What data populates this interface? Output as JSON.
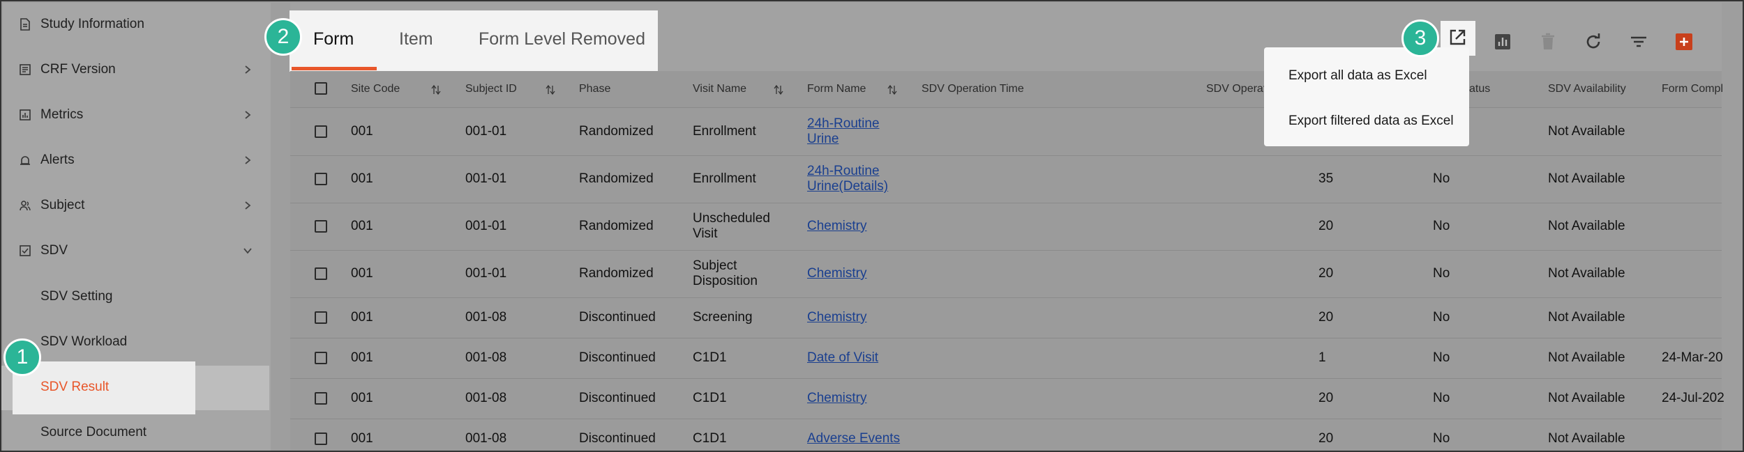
{
  "sidebar": {
    "items": [
      {
        "label": "Study Information",
        "icon": "document-icon",
        "expand": ""
      },
      {
        "label": "CRF Version",
        "icon": "form-icon",
        "expand": "chevron-right"
      },
      {
        "label": "Metrics",
        "icon": "chart-icon",
        "expand": "chevron-right"
      },
      {
        "label": "Alerts",
        "icon": "alarm-icon",
        "expand": "chevron-right"
      },
      {
        "label": "Subject",
        "icon": "people-icon",
        "expand": "chevron-right"
      },
      {
        "label": "SDV",
        "icon": "checklist-icon",
        "expand": "chevron-down"
      }
    ],
    "sub_items": [
      {
        "label": "SDV Setting"
      },
      {
        "label": "SDV Workload"
      },
      {
        "label": "SDV Result",
        "active": true
      },
      {
        "label": "Source Document"
      }
    ]
  },
  "tabs": [
    {
      "label": "Form",
      "active": true
    },
    {
      "label": "Item"
    },
    {
      "label": "Form Level Removed"
    }
  ],
  "toolbar": {
    "icons": [
      "export-icon",
      "bar-chart-icon",
      "delete-icon",
      "refresh-icon",
      "filter-icon",
      "add-icon"
    ]
  },
  "export_menu": {
    "items": [
      "Export all data as Excel",
      "Export filtered data as Excel"
    ]
  },
  "table": {
    "columns": [
      "Site Code",
      "Subject ID",
      "Phase",
      "Visit Name",
      "Form Name",
      "SDV Operation Time",
      "SDV Operator",
      "atus",
      "SDV Availability",
      "Form Compl"
    ],
    "rows": [
      {
        "site": "001",
        "subject": "001-01",
        "phase": "Randomized",
        "visit": [
          "Enrollment"
        ],
        "form": [
          "24h-Routine",
          "Urine"
        ],
        "count": "",
        "status": "",
        "avail": "Not Available",
        "completed": ""
      },
      {
        "site": "001",
        "subject": "001-01",
        "phase": "Randomized",
        "visit": [
          "Enrollment"
        ],
        "form": [
          "24h-Routine",
          "Urine(Details)"
        ],
        "count": "35",
        "status": "No",
        "avail": "Not Available",
        "completed": ""
      },
      {
        "site": "001",
        "subject": "001-01",
        "phase": "Randomized",
        "visit": [
          "Unscheduled",
          "Visit"
        ],
        "form": [
          "Chemistry"
        ],
        "count": "20",
        "status": "No",
        "avail": "Not Available",
        "completed": ""
      },
      {
        "site": "001",
        "subject": "001-01",
        "phase": "Randomized",
        "visit": [
          "Subject",
          "Disposition"
        ],
        "form": [
          "Chemistry"
        ],
        "count": "20",
        "status": "No",
        "avail": "Not Available",
        "completed": ""
      },
      {
        "site": "001",
        "subject": "001-08",
        "phase": "Discontinued",
        "visit": [
          "Screening"
        ],
        "form": [
          "Chemistry"
        ],
        "count": "20",
        "status": "No",
        "avail": "Not Available",
        "completed": ""
      },
      {
        "site": "001",
        "subject": "001-08",
        "phase": "Discontinued",
        "visit": [
          "C1D1"
        ],
        "form": [
          "Date of Visit"
        ],
        "count": "1",
        "status": "No",
        "avail": "Not Available",
        "completed": "24-Mar-20"
      },
      {
        "site": "001",
        "subject": "001-08",
        "phase": "Discontinued",
        "visit": [
          "C1D1"
        ],
        "form": [
          "Chemistry"
        ],
        "count": "20",
        "status": "No",
        "avail": "Not Available",
        "completed": "24-Jul-202"
      },
      {
        "site": "001",
        "subject": "001-08",
        "phase": "Discontinued",
        "visit": [
          "C1D1"
        ],
        "form": [
          "Adverse Events"
        ],
        "count": "20",
        "status": "No",
        "avail": "Not Available",
        "completed": ""
      }
    ]
  },
  "callouts": [
    "1",
    "2",
    "3"
  ],
  "colors": {
    "accent": "#e8562a",
    "callout": "#2bb597",
    "link": "#1a3f8f"
  }
}
